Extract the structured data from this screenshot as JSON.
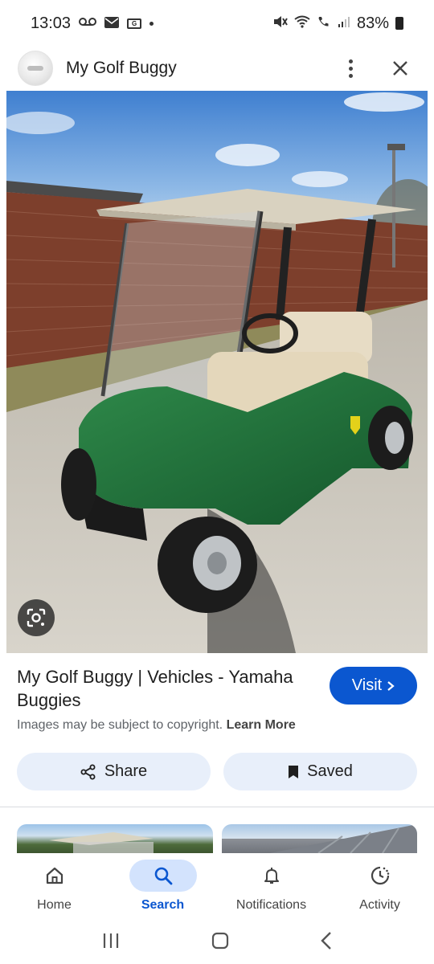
{
  "status_bar": {
    "time": "13:03",
    "battery": "83%",
    "left_icons": [
      "voicemail-icon",
      "mail-icon",
      "news-icon"
    ],
    "right_icons": [
      "mute-icon",
      "wifi-icon",
      "wifi-calling-icon",
      "signal-icon",
      "battery-icon"
    ]
  },
  "header": {
    "title": "My Golf Buggy"
  },
  "result": {
    "title": "My Golf Buggy | Vehicles - Yamaha Buggies",
    "visit_label": "Visit",
    "copyright_text": "Images may be subject to copyright.",
    "learn_more": "Learn More"
  },
  "actions": {
    "share_label": "Share",
    "saved_label": "Saved"
  },
  "bottom_nav": {
    "items": [
      {
        "label": "Home",
        "icon": "home-icon",
        "active": false
      },
      {
        "label": "Search",
        "icon": "search-icon",
        "active": true
      },
      {
        "label": "Notifications",
        "icon": "bell-icon",
        "active": false
      },
      {
        "label": "Activity",
        "icon": "activity-icon",
        "active": false
      }
    ]
  },
  "colors": {
    "accent": "#0b57d0",
    "pill_bg": "#e8effa",
    "active_nav_bg": "#d3e3fd"
  }
}
